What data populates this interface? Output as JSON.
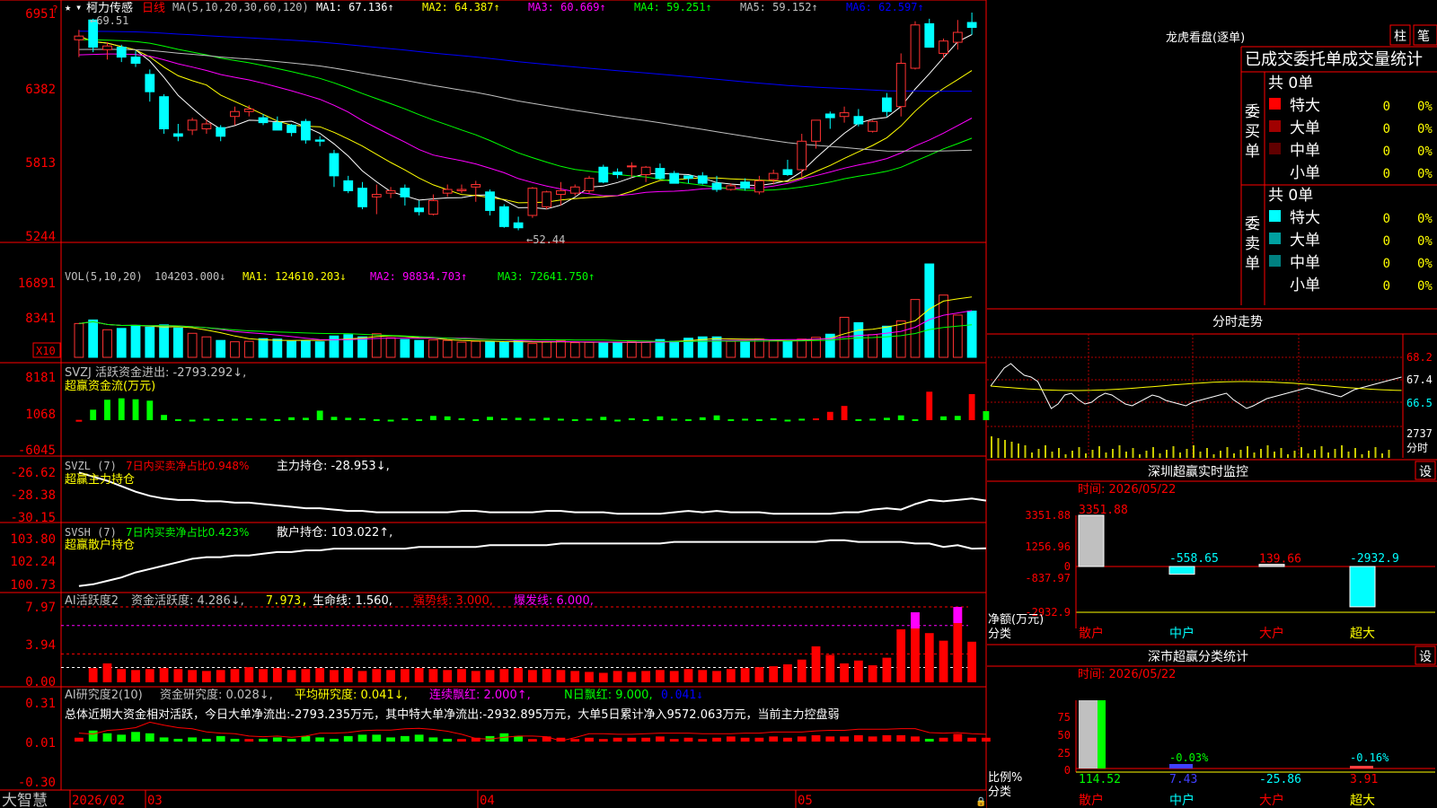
{
  "header": {
    "stock_name": "柯力传感",
    "period": "日线",
    "ma_label": "MA(5,10,20,30,60,120)",
    "ma_values": [
      {
        "name": "MA1",
        "value": "67.136↑",
        "color": "#ffffff"
      },
      {
        "name": "MA2",
        "value": "64.387↑",
        "color": "#ffff00"
      },
      {
        "name": "MA3",
        "value": "60.669↑",
        "color": "#ff00ff"
      },
      {
        "name": "MA4",
        "value": "59.251↑",
        "color": "#00ff00"
      },
      {
        "name": "MA5",
        "value": "59.152↑",
        "color": "#c0c0c0"
      },
      {
        "name": "MA6",
        "value": "62.597↑",
        "color": "#0000ff"
      }
    ],
    "high_marker": "69.51",
    "low_marker": "52.44"
  },
  "price_axis": [
    "6951",
    "6382",
    "5813",
    "5244"
  ],
  "volume": {
    "label": "VOL(5,10,20)",
    "value": "104203.000↓",
    "ma": [
      {
        "name": "MA1",
        "value": "124610.203↓",
        "color": "#ffff00"
      },
      {
        "name": "MA2",
        "value": "98834.703↑",
        "color": "#ff00ff"
      },
      {
        "name": "MA3",
        "value": "72641.750↑",
        "color": "#00ff00"
      }
    ],
    "axis": [
      "16891",
      "8341"
    ],
    "unit": "X10"
  },
  "svzj": {
    "line1": "SVZJ  活跃资金进出: -2793.292↓,",
    "line2": "超赢资金流(万元)",
    "axis": [
      "8181",
      "1068",
      "-6045"
    ]
  },
  "svzl": {
    "name": "SVZL (7)",
    "ratio": "7日内买卖净占比0.948%",
    "hold": "主力持仓: -28.953↓,",
    "line2": "超赢主力持仓",
    "axis": [
      "-26.62",
      "-28.38",
      "-30.15"
    ]
  },
  "svsh": {
    "name": "SVSH (7)",
    "ratio": "7日内买卖净占比0.423%",
    "hold": "散户持仓: 103.022↑,",
    "line2": "超赢散户持仓",
    "axis": [
      "103.80",
      "102.24",
      "100.73"
    ]
  },
  "ai_active": {
    "name": "AI活跃度2",
    "v1": "资金活跃度: 4.286↓,",
    "v2": "7.973,",
    "v3": "生命线: 1.560,",
    "v4": "强势线: 3.000,",
    "v5": "爆发线: 6.000,",
    "axis": [
      "7.97",
      "3.94",
      "0.00"
    ]
  },
  "ai_research": {
    "name": "AI研究度2(10)",
    "v1": "资金研究度: 0.028↓,",
    "v2": "平均研究度: 0.041↓,",
    "v3": "连续飘红: 2.000↑,",
    "v4": "N日飘红: 9.000,",
    "v5": "0.041↓",
    "summary": "总体近期大资金相对活跃，今日大单净流出:-2793.235万元，其中特大单净流出:-2932.895万元，大单5日累计净入9572.063万元，当前主力控盘弱",
    "axis": [
      "0.31",
      "0.01",
      "-0.30"
    ]
  },
  "bottom_bar": {
    "brand": "大智慧",
    "dates": [
      "2026/02",
      "03",
      "04",
      "05"
    ]
  },
  "right_panel": {
    "dragon_title": "龙虎看盘(逐单)",
    "btn_zhu": "柱",
    "btn_bi": "笔",
    "stats_header": "已成交委托单成交量统计",
    "buy_label": "委买单",
    "sell_label": "委卖单",
    "buy_total": "共 0单",
    "sell_total": "共 0单",
    "buy_rows": [
      {
        "name": "特大",
        "color": "#ff0000",
        "count": "0",
        "pct": "0%"
      },
      {
        "name": "大单",
        "color": "#a00000",
        "count": "0",
        "pct": "0%"
      },
      {
        "name": "中单",
        "color": "#600000",
        "count": "0",
        "pct": "0%"
      },
      {
        "name": "小单",
        "color": "",
        "count": "0",
        "pct": "0%"
      }
    ],
    "sell_rows": [
      {
        "name": "特大",
        "color": "#00ffff",
        "count": "0",
        "pct": "0%"
      },
      {
        "name": "大单",
        "color": "#00a0a0",
        "count": "0",
        "pct": "0%"
      },
      {
        "name": "中单",
        "color": "#008080",
        "count": "0",
        "pct": "0%"
      },
      {
        "name": "小单",
        "color": "",
        "count": "0",
        "pct": "0%"
      }
    ],
    "intraday_title": "分时走势",
    "intraday_axis": [
      "68.2",
      "67.4",
      "66.5",
      "2737",
      "分时"
    ],
    "monitor_title": "深圳超赢实时监控",
    "monitor_btn": "设",
    "monitor_time": "时间: 2026/05/22",
    "monitor_axis": [
      "3351.88",
      "1256.96",
      "0",
      "-837.97",
      "-2932.9"
    ],
    "monitor_ylabel": "净额(万元)",
    "monitor_xlabel": "分类",
    "monitor_cats": [
      "散户",
      "中户",
      "大户",
      "超大"
    ],
    "monitor_values": [
      "3351.88",
      "-558.65",
      "139.66",
      "-2932.9"
    ],
    "class_title": "深市超赢分类统计",
    "class_btn": "设",
    "class_time": "时间: 2026/05/22",
    "class_axis": [
      "75",
      "50",
      "25",
      "0"
    ],
    "class_ylabel": "比例%",
    "class_xlabel": "分类",
    "class_cats": [
      "散户",
      "中户",
      "大户",
      "超大"
    ],
    "class_values": [
      "114.52",
      "7.43",
      "-25.86",
      "3.91"
    ],
    "class_top": [
      "",
      "-0.03%",
      "",
      "-0.16%"
    ]
  },
  "chart_data": [
    {
      "type": "candlestick",
      "title": "柯力传感 日线",
      "ylim": [
        52.0,
        70.0
      ],
      "candles": [
        [
          67.8,
          68.6,
          66.4,
          68.1
        ],
        [
          69.4,
          69.5,
          66.8,
          67.2
        ],
        [
          67.0,
          67.6,
          66.2,
          67.3
        ],
        [
          67.2,
          67.4,
          66.0,
          66.4
        ],
        [
          66.4,
          66.9,
          65.6,
          65.9
        ],
        [
          65.0,
          65.4,
          62.8,
          63.6
        ],
        [
          63.2,
          63.4,
          60.2,
          60.6
        ],
        [
          60.2,
          61.0,
          59.6,
          60.0
        ],
        [
          60.5,
          61.5,
          60.1,
          61.3
        ],
        [
          60.6,
          61.4,
          60.2,
          61.0
        ],
        [
          60.7,
          60.9,
          59.6,
          60.0
        ],
        [
          61.6,
          62.4,
          60.9,
          62.0
        ],
        [
          62.0,
          62.5,
          61.6,
          62.2
        ],
        [
          61.5,
          61.8,
          60.9,
          61.1
        ],
        [
          61.1,
          61.6,
          60.8,
          60.5
        ],
        [
          60.9,
          61.0,
          60.0,
          60.3
        ],
        [
          61.2,
          61.4,
          59.4,
          59.7
        ],
        [
          59.7,
          60.0,
          59.2,
          59.6
        ],
        [
          58.6,
          58.9,
          55.9,
          56.8
        ],
        [
          56.4,
          56.8,
          55.4,
          55.6
        ],
        [
          55.8,
          56.3,
          54.1,
          54.3
        ],
        [
          55.1,
          56.1,
          53.7,
          55.3
        ],
        [
          55.4,
          55.9,
          55.0,
          55.6
        ],
        [
          55.8,
          56.1,
          54.4,
          55.1
        ],
        [
          54.2,
          54.8,
          53.6,
          53.9
        ],
        [
          53.7,
          55.3,
          53.6,
          54.8
        ],
        [
          55.4,
          56.1,
          55.1,
          55.7
        ],
        [
          55.6,
          56.1,
          55.4,
          55.7
        ],
        [
          55.9,
          56.4,
          54.7,
          56.1
        ],
        [
          55.5,
          55.7,
          53.6,
          54.0
        ],
        [
          54.3,
          54.5,
          52.6,
          52.7
        ],
        [
          53.0,
          53.5,
          52.4,
          52.6
        ],
        [
          53.6,
          55.9,
          53.4,
          55.8
        ],
        [
          54.3,
          55.6,
          54.1,
          55.5
        ],
        [
          55.3,
          56.3,
          54.4,
          55.6
        ],
        [
          55.4,
          56.1,
          55.2,
          55.9
        ],
        [
          55.6,
          56.8,
          55.4,
          56.6
        ],
        [
          57.5,
          57.7,
          56.2,
          56.3
        ],
        [
          57.1,
          57.4,
          56.6,
          56.9
        ],
        [
          57.6,
          57.9,
          56.7,
          57.6
        ],
        [
          56.9,
          57.6,
          56.3,
          57.5
        ],
        [
          57.4,
          57.8,
          56.5,
          56.6
        ],
        [
          57.0,
          57.2,
          56.4,
          56.2
        ],
        [
          56.8,
          56.8,
          56.2,
          56.6
        ],
        [
          56.8,
          57.1,
          56.1,
          56.2
        ],
        [
          56.2,
          56.8,
          55.5,
          55.7
        ],
        [
          55.7,
          56.2,
          55.6,
          56.0
        ],
        [
          56.3,
          56.6,
          55.6,
          55.8
        ],
        [
          55.5,
          56.8,
          55.3,
          56.4
        ],
        [
          56.5,
          57.3,
          56.1,
          57.0
        ],
        [
          57.3,
          58.1,
          56.8,
          56.9
        ],
        [
          57.3,
          60.2,
          56.7,
          59.6
        ],
        [
          59.6,
          61.3,
          59.0,
          61.3
        ],
        [
          61.8,
          62.0,
          60.6,
          61.5
        ],
        [
          61.6,
          62.4,
          61.1,
          61.9
        ],
        [
          61.6,
          62.2,
          60.8,
          61.0
        ],
        [
          60.4,
          61.3,
          60.3,
          61.2
        ],
        [
          63.1,
          63.5,
          61.6,
          62.0
        ],
        [
          62.4,
          66.7,
          61.6,
          65.9
        ],
        [
          65.5,
          69.3,
          65.4,
          69.0
        ],
        [
          69.1,
          69.5,
          67.2,
          67.2
        ],
        [
          66.7,
          67.9,
          66.3,
          67.7
        ],
        [
          67.6,
          69.4,
          67.0,
          68.4
        ],
        [
          69.2,
          70.0,
          68.2,
          68.8
        ]
      ]
    },
    {
      "type": "bar",
      "title": "VOL(5,10,20)",
      "values": [
        7600,
        8400,
        6200,
        6500,
        7200,
        6800,
        7300,
        6600,
        5400,
        4600,
        3800,
        3500,
        3600,
        4200,
        4100,
        3600,
        3700,
        3500,
        4800,
        5100,
        4600,
        5300,
        4400,
        4000,
        3800,
        3900,
        3800,
        3400,
        3600,
        3500,
        3400,
        3700,
        3100,
        3500,
        3700,
        3300,
        3400,
        3200,
        3300,
        3500,
        3400,
        4000,
        3600,
        4300,
        4600,
        4600,
        3600,
        3400,
        4100,
        3800,
        3700,
        4100,
        4500,
        5200,
        9000,
        7800,
        5100,
        7000,
        8200,
        13000,
        21000,
        14000,
        9500,
        10400
      ],
      "ylim": [
        0,
        21000
      ]
    },
    {
      "type": "bar",
      "title": "SVZJ",
      "values": [
        50,
        -2200,
        -4300,
        -4600,
        -4400,
        -4100,
        -1100,
        -200,
        -100,
        -300,
        -200,
        -300,
        -400,
        -300,
        -200,
        -600,
        -500,
        -2000,
        -700,
        -500,
        -400,
        -200,
        -100,
        -400,
        -200,
        -900,
        -800,
        -400,
        -200,
        -700,
        -400,
        -500,
        -300,
        -500,
        -300,
        -200,
        -300,
        -700,
        -100,
        -400,
        -200,
        -800,
        -300,
        -200,
        -600,
        -1000,
        -200,
        -300,
        -200,
        -400,
        -100,
        -300,
        300,
        1400,
        2400,
        -200,
        -300,
        -500,
        -1000,
        -200,
        4800,
        -800,
        -900,
        4400,
        -1900
      ],
      "ylim": [
        -6045,
        8181
      ]
    },
    {
      "type": "line",
      "title": "SVZL (7)",
      "ylim": [
        -30.15,
        -26.62
      ],
      "values": [
        -26.9,
        -27.2,
        -27.5,
        -27.9,
        -28.3,
        -28.6,
        -28.8,
        -28.9,
        -28.9,
        -29.0,
        -29.0,
        -29.1,
        -29.1,
        -29.2,
        -29.3,
        -29.4,
        -29.5,
        -29.5,
        -29.6,
        -29.7,
        -29.7,
        -29.8,
        -29.8,
        -29.8,
        -29.8,
        -29.8,
        -29.8,
        -29.7,
        -29.7,
        -29.8,
        -29.8,
        -29.8,
        -29.8,
        -29.7,
        -29.7,
        -29.8,
        -29.8,
        -29.8,
        -29.9,
        -29.9,
        -29.9,
        -29.9,
        -29.8,
        -29.7,
        -29.8,
        -29.7,
        -29.8,
        -29.8,
        -29.8,
        -29.9,
        -29.9,
        -29.9,
        -29.9,
        -29.9,
        -29.8,
        -29.8,
        -29.6,
        -29.5,
        -29.6,
        -29.2,
        -28.9,
        -29.0,
        -28.9,
        -28.8,
        -28.95
      ]
    },
    {
      "type": "line",
      "title": "SVSH (7)",
      "ylim": [
        100.73,
        103.8
      ],
      "values": [
        100.8,
        100.9,
        101.1,
        101.3,
        101.6,
        101.8,
        102.0,
        102.2,
        102.4,
        102.5,
        102.5,
        102.6,
        102.6,
        102.7,
        102.8,
        102.8,
        102.9,
        102.9,
        103.0,
        103.0,
        103.0,
        103.0,
        103.0,
        103.0,
        103.1,
        103.1,
        103.1,
        103.1,
        103.1,
        103.2,
        103.2,
        103.2,
        103.2,
        103.2,
        103.3,
        103.3,
        103.3,
        103.3,
        103.3,
        103.3,
        103.3,
        103.3,
        103.4,
        103.4,
        103.4,
        103.4,
        103.4,
        103.4,
        103.4,
        103.4,
        103.4,
        103.4,
        103.4,
        103.5,
        103.5,
        103.4,
        103.4,
        103.4,
        103.4,
        103.3,
        103.3,
        103.1,
        103.2,
        103.0,
        103.02
      ]
    },
    {
      "type": "bar",
      "title": "AI活跃度2",
      "ylim": [
        0,
        7.97
      ],
      "values": [
        1.5,
        2.0,
        1.4,
        1.3,
        1.4,
        1.5,
        1.4,
        1.3,
        1.2,
        1.3,
        1.4,
        1.6,
        1.4,
        1.5,
        1.3,
        1.4,
        1.5,
        1.3,
        1.5,
        1.2,
        1.4,
        1.3,
        1.4,
        1.5,
        1.4,
        1.3,
        1.4,
        1.2,
        1.3,
        1.4,
        1.5,
        1.3,
        1.4,
        1.3,
        1.2,
        1.1,
        1.0,
        1.2,
        1.1,
        1.2,
        1.3,
        1.2,
        1.4,
        1.3,
        1.2,
        1.4,
        1.5,
        1.6,
        1.7,
        1.9,
        2.4,
        3.8,
        2.9,
        2.0,
        2.3,
        1.8,
        2.6,
        5.6,
        7.4,
        5.2,
        4.4,
        7.97,
        4.29
      ]
    },
    {
      "type": "bar",
      "title": "AI研究度2(10)",
      "ylim": [
        -0.3,
        0.31
      ],
      "values": [
        0.03,
        -0.08,
        -0.06,
        -0.05,
        -0.07,
        -0.06,
        -0.03,
        -0.02,
        -0.03,
        -0.02,
        -0.04,
        -0.02,
        0.02,
        -0.02,
        -0.03,
        -0.02,
        -0.04,
        -0.03,
        -0.02,
        -0.04,
        -0.05,
        -0.05,
        -0.03,
        -0.04,
        -0.05,
        -0.03,
        -0.02,
        0.02,
        0.03,
        -0.04,
        -0.06,
        -0.04,
        0.02,
        0.04,
        0.03,
        0.02,
        0.03,
        0.02,
        0.03,
        0.03,
        0.03,
        0.04,
        0.02,
        0.03,
        0.02,
        0.03,
        0.04,
        0.03,
        0.03,
        0.04,
        0.03,
        0.04,
        0.05,
        0.04,
        0.04,
        0.05,
        0.04,
        0.05,
        0.05,
        0.04,
        -0.02,
        0.03,
        0.06,
        0.03,
        0.03
      ]
    }
  ]
}
